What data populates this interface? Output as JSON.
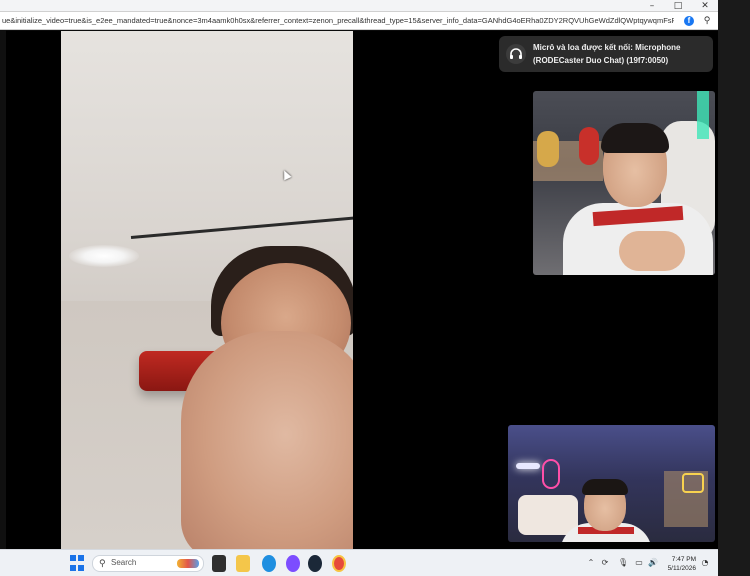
{
  "browser": {
    "window_controls": {
      "minimize": "–",
      "maximize": "□",
      "close": "✕"
    },
    "url": "ue&initialize_video=true&is_e2ee_mandated=true&nonce=3m4aamk0h0sx&referrer_context=zenon_precall&thread_type=15&server_info_data=GANhdG4oERha0ZDY2RQVUhGeWdZdlQWptqywqmFsRs..."
  },
  "call": {
    "toast": {
      "line1": "Micrô và loa được kết nối: Microphone",
      "line2": "(RODECaster Duo Chat) (19f7:0050)"
    }
  },
  "taskbar": {
    "search_placeholder": "Search",
    "clock_time": "7:47 PM",
    "clock_date": "5/11/2026"
  },
  "colors": {
    "accent": "#1a73e8",
    "toast_bg": "#2b2b2b",
    "call_bg": "#000000",
    "taskbar_bg": "#eef1f5"
  }
}
